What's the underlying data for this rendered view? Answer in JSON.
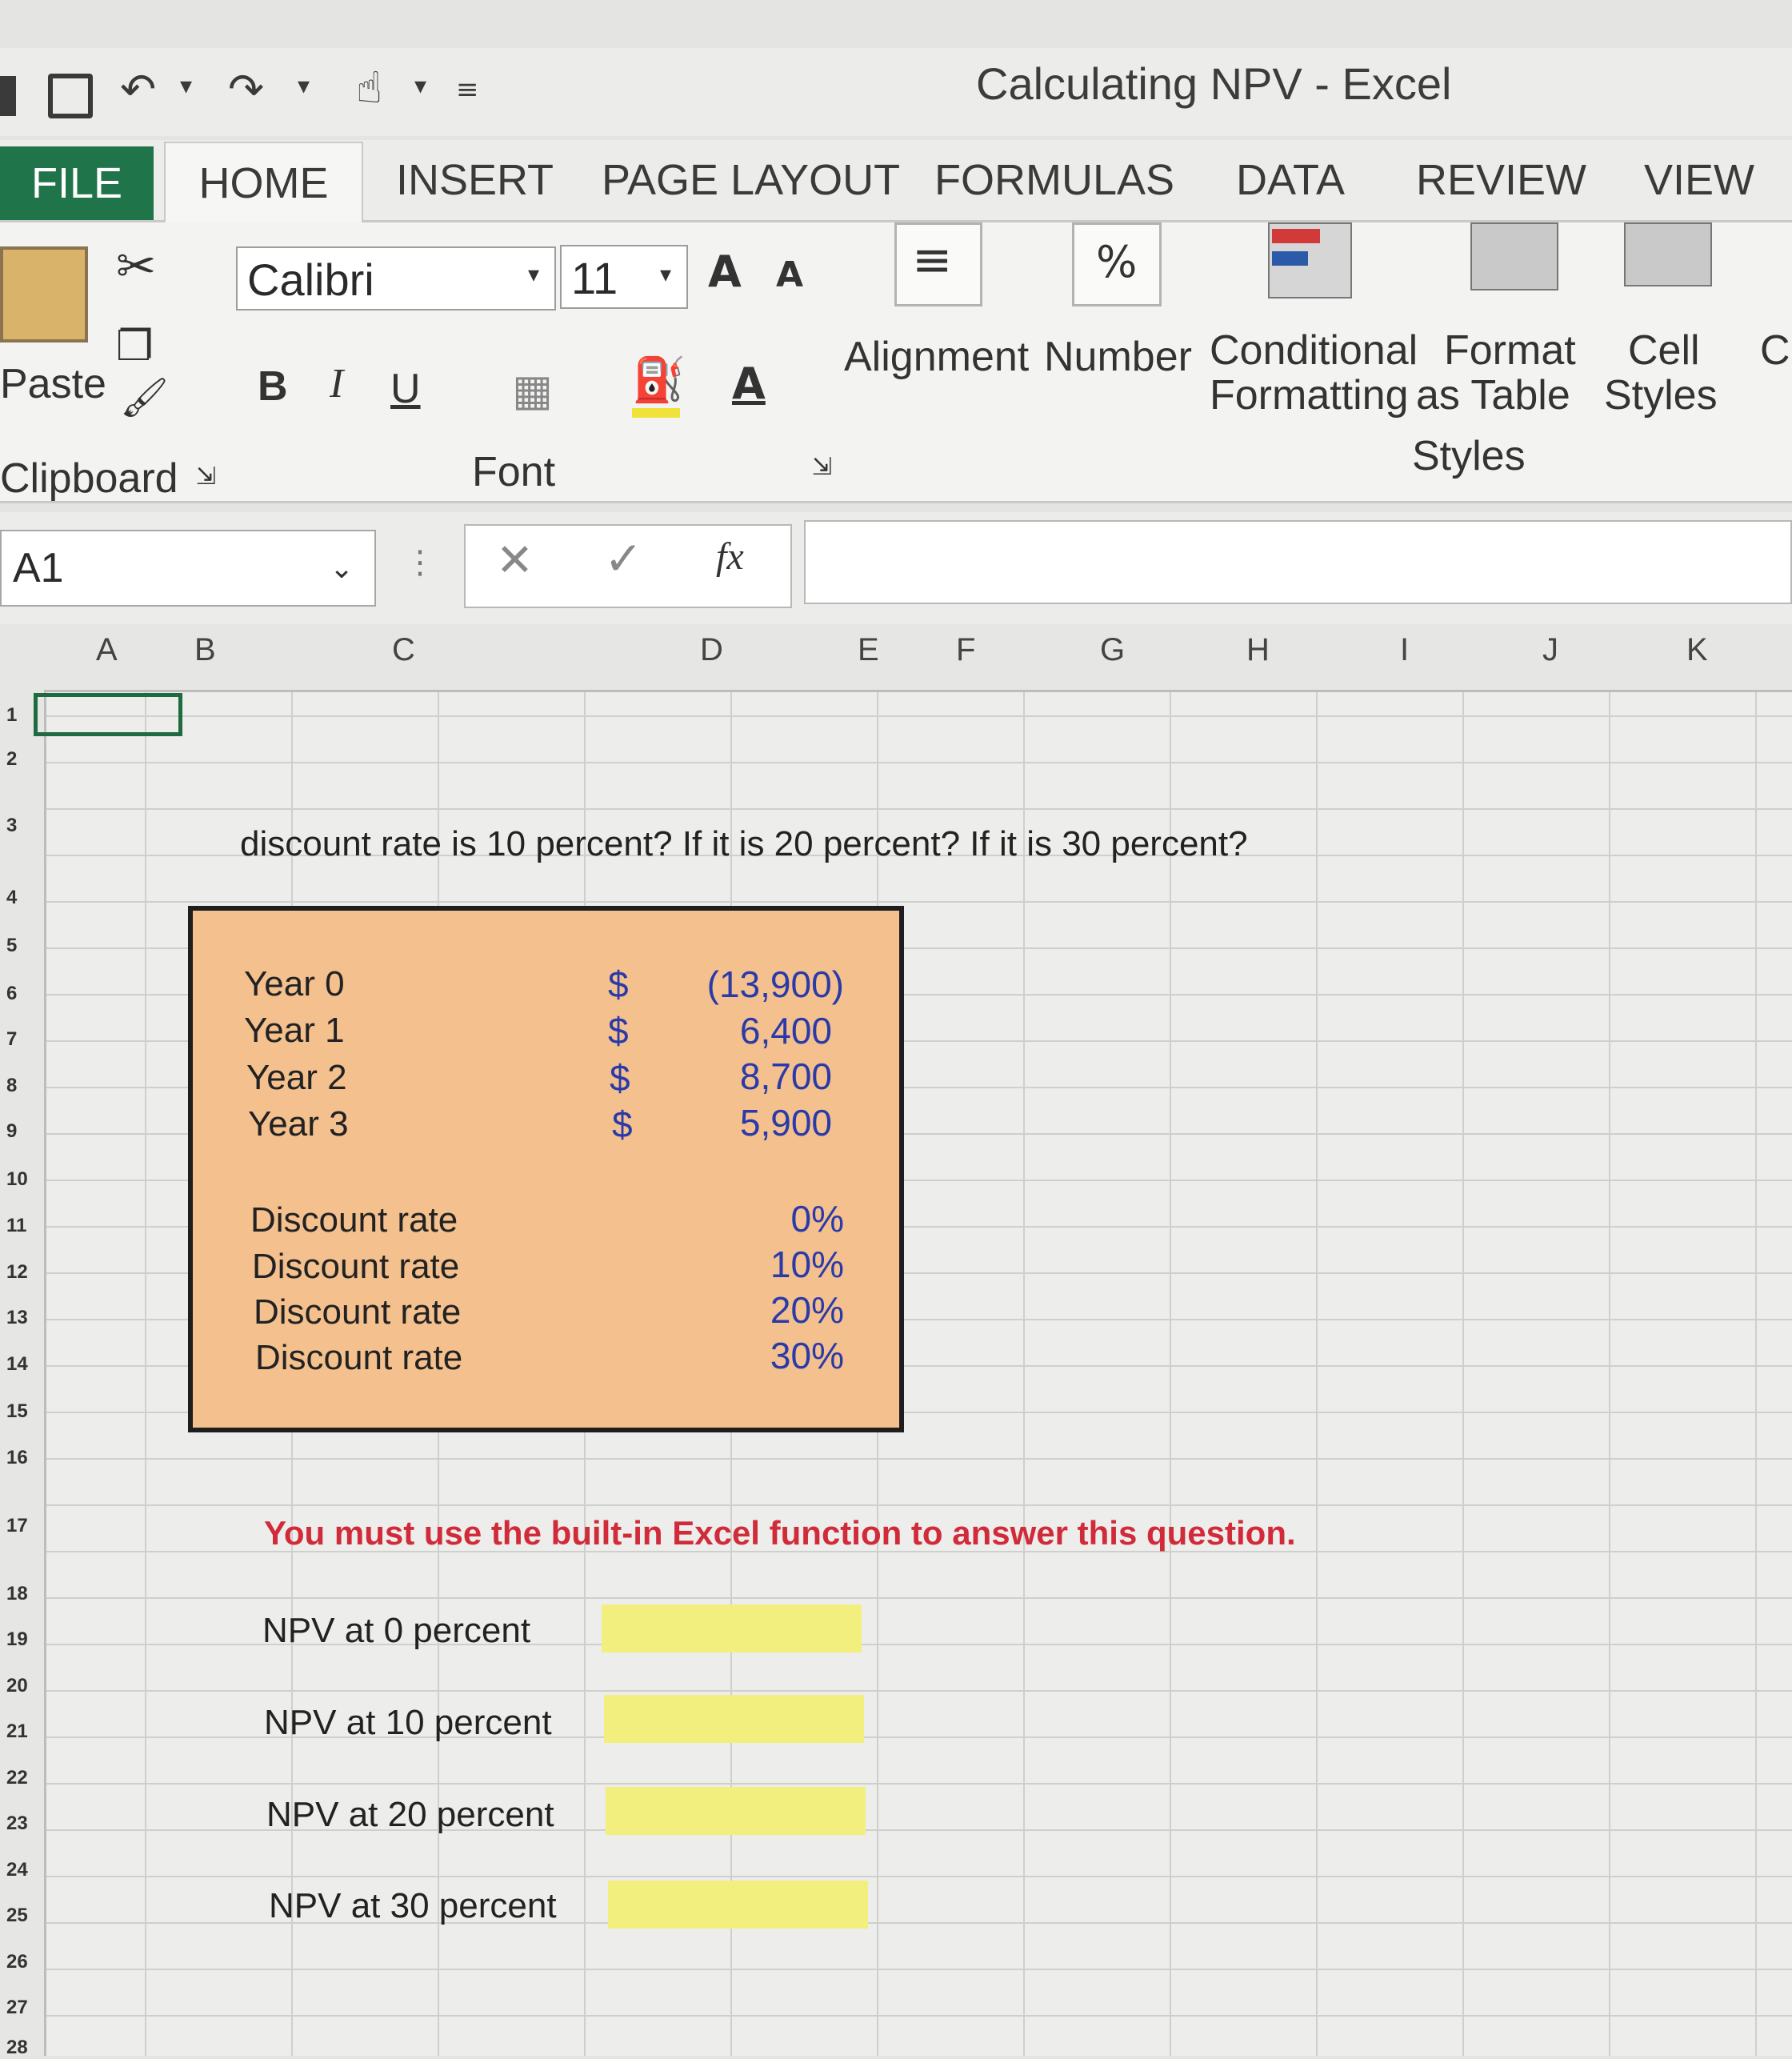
{
  "window": {
    "title": "Calculating NPV - Excel"
  },
  "tabs": [
    "FILE",
    "HOME",
    "INSERT",
    "PAGE LAYOUT",
    "FORMULAS",
    "DATA",
    "REVIEW",
    "VIEW"
  ],
  "ribbon": {
    "clipboard": {
      "paste_label": "Paste",
      "group_label": "Clipboard"
    },
    "font": {
      "name": "Calibri",
      "size": "11",
      "group_label": "Font",
      "bold": "B",
      "italic": "I",
      "underline": "U"
    },
    "alignment_label": "Alignment",
    "number_label": "Number",
    "conditional_formatting_label_1": "Conditional",
    "conditional_formatting_label_2": "Formatting",
    "format_table_label_1": "Format",
    "format_table_label_2": "as Table",
    "cell_styles_label_1": "Cell",
    "cell_styles_label_2": "Styles",
    "styles_group_label": "Styles",
    "cut_partial": "C"
  },
  "formula_bar": {
    "name_box": "A1",
    "formula": ""
  },
  "columns": [
    "A",
    "B",
    "C",
    "D",
    "E",
    "F",
    "G",
    "H",
    "I",
    "J",
    "K"
  ],
  "rows": [
    "1",
    "2",
    "3",
    "4",
    "5",
    "6",
    "7",
    "8",
    "9",
    "10",
    "11",
    "12",
    "13",
    "14",
    "15",
    "16",
    "17",
    "18",
    "19",
    "20",
    "21",
    "22",
    "23",
    "24",
    "25",
    "26",
    "27",
    "28"
  ],
  "sheet": {
    "question": "discount rate is 10 percent? If it is 20 percent? If it is 30 percent?",
    "cash_flows": [
      {
        "label": "Year 0",
        "currency": "$",
        "value": "(13,900)"
      },
      {
        "label": "Year 1",
        "currency": "$",
        "value": "6,400"
      },
      {
        "label": "Year 2",
        "currency": "$",
        "value": "8,700"
      },
      {
        "label": "Year 3",
        "currency": "$",
        "value": "5,900"
      }
    ],
    "discount_rates": [
      {
        "label": "Discount rate",
        "value": "0%"
      },
      {
        "label": "Discount rate",
        "value": "10%"
      },
      {
        "label": "Discount rate",
        "value": "20%"
      },
      {
        "label": "Discount rate",
        "value": "30%"
      }
    ],
    "note": "You must use the built-in Excel function to answer this question.",
    "npv_rows": [
      {
        "label": "NPV at 0 percent",
        "value": ""
      },
      {
        "label": "NPV at 10 percent",
        "value": ""
      },
      {
        "label": "NPV at 20 percent",
        "value": ""
      },
      {
        "label": "NPV at 30 percent",
        "value": ""
      }
    ]
  }
}
